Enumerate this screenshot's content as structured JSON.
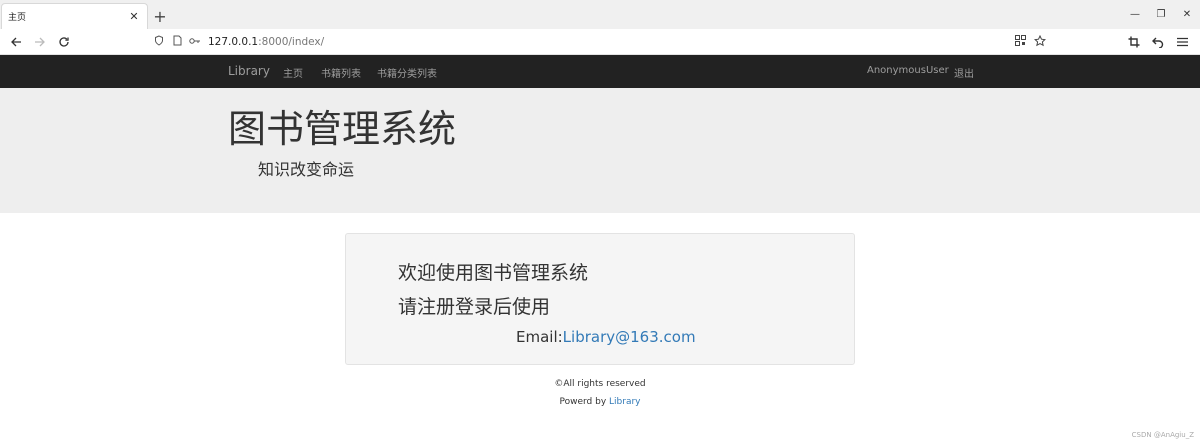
{
  "browser": {
    "tab_title": "主页",
    "tab_close": "✕",
    "new_tab": "+",
    "window_controls": [
      "—",
      "❐",
      "✕"
    ],
    "url_host": "127.0.0.1",
    "url_rest": ":8000/index/"
  },
  "navbar": {
    "brand": "Library",
    "links": [
      "主页",
      "书籍列表",
      "书籍分类列表"
    ],
    "user": "AnonymousUser",
    "logout": "退出"
  },
  "jumbotron": {
    "title": "图书管理系统",
    "subtitle": "知识改变命运"
  },
  "well": {
    "line1": "欢迎使用图书管理系统",
    "line2": "请注册登录后使用",
    "email_label": "Email:",
    "email": "Library@163.com"
  },
  "footer": {
    "rights": "©All rights reserved",
    "powered_prefix": "Powerd by ",
    "powered_link": "Library"
  },
  "watermark": "CSDN @AnAgiu_Z"
}
